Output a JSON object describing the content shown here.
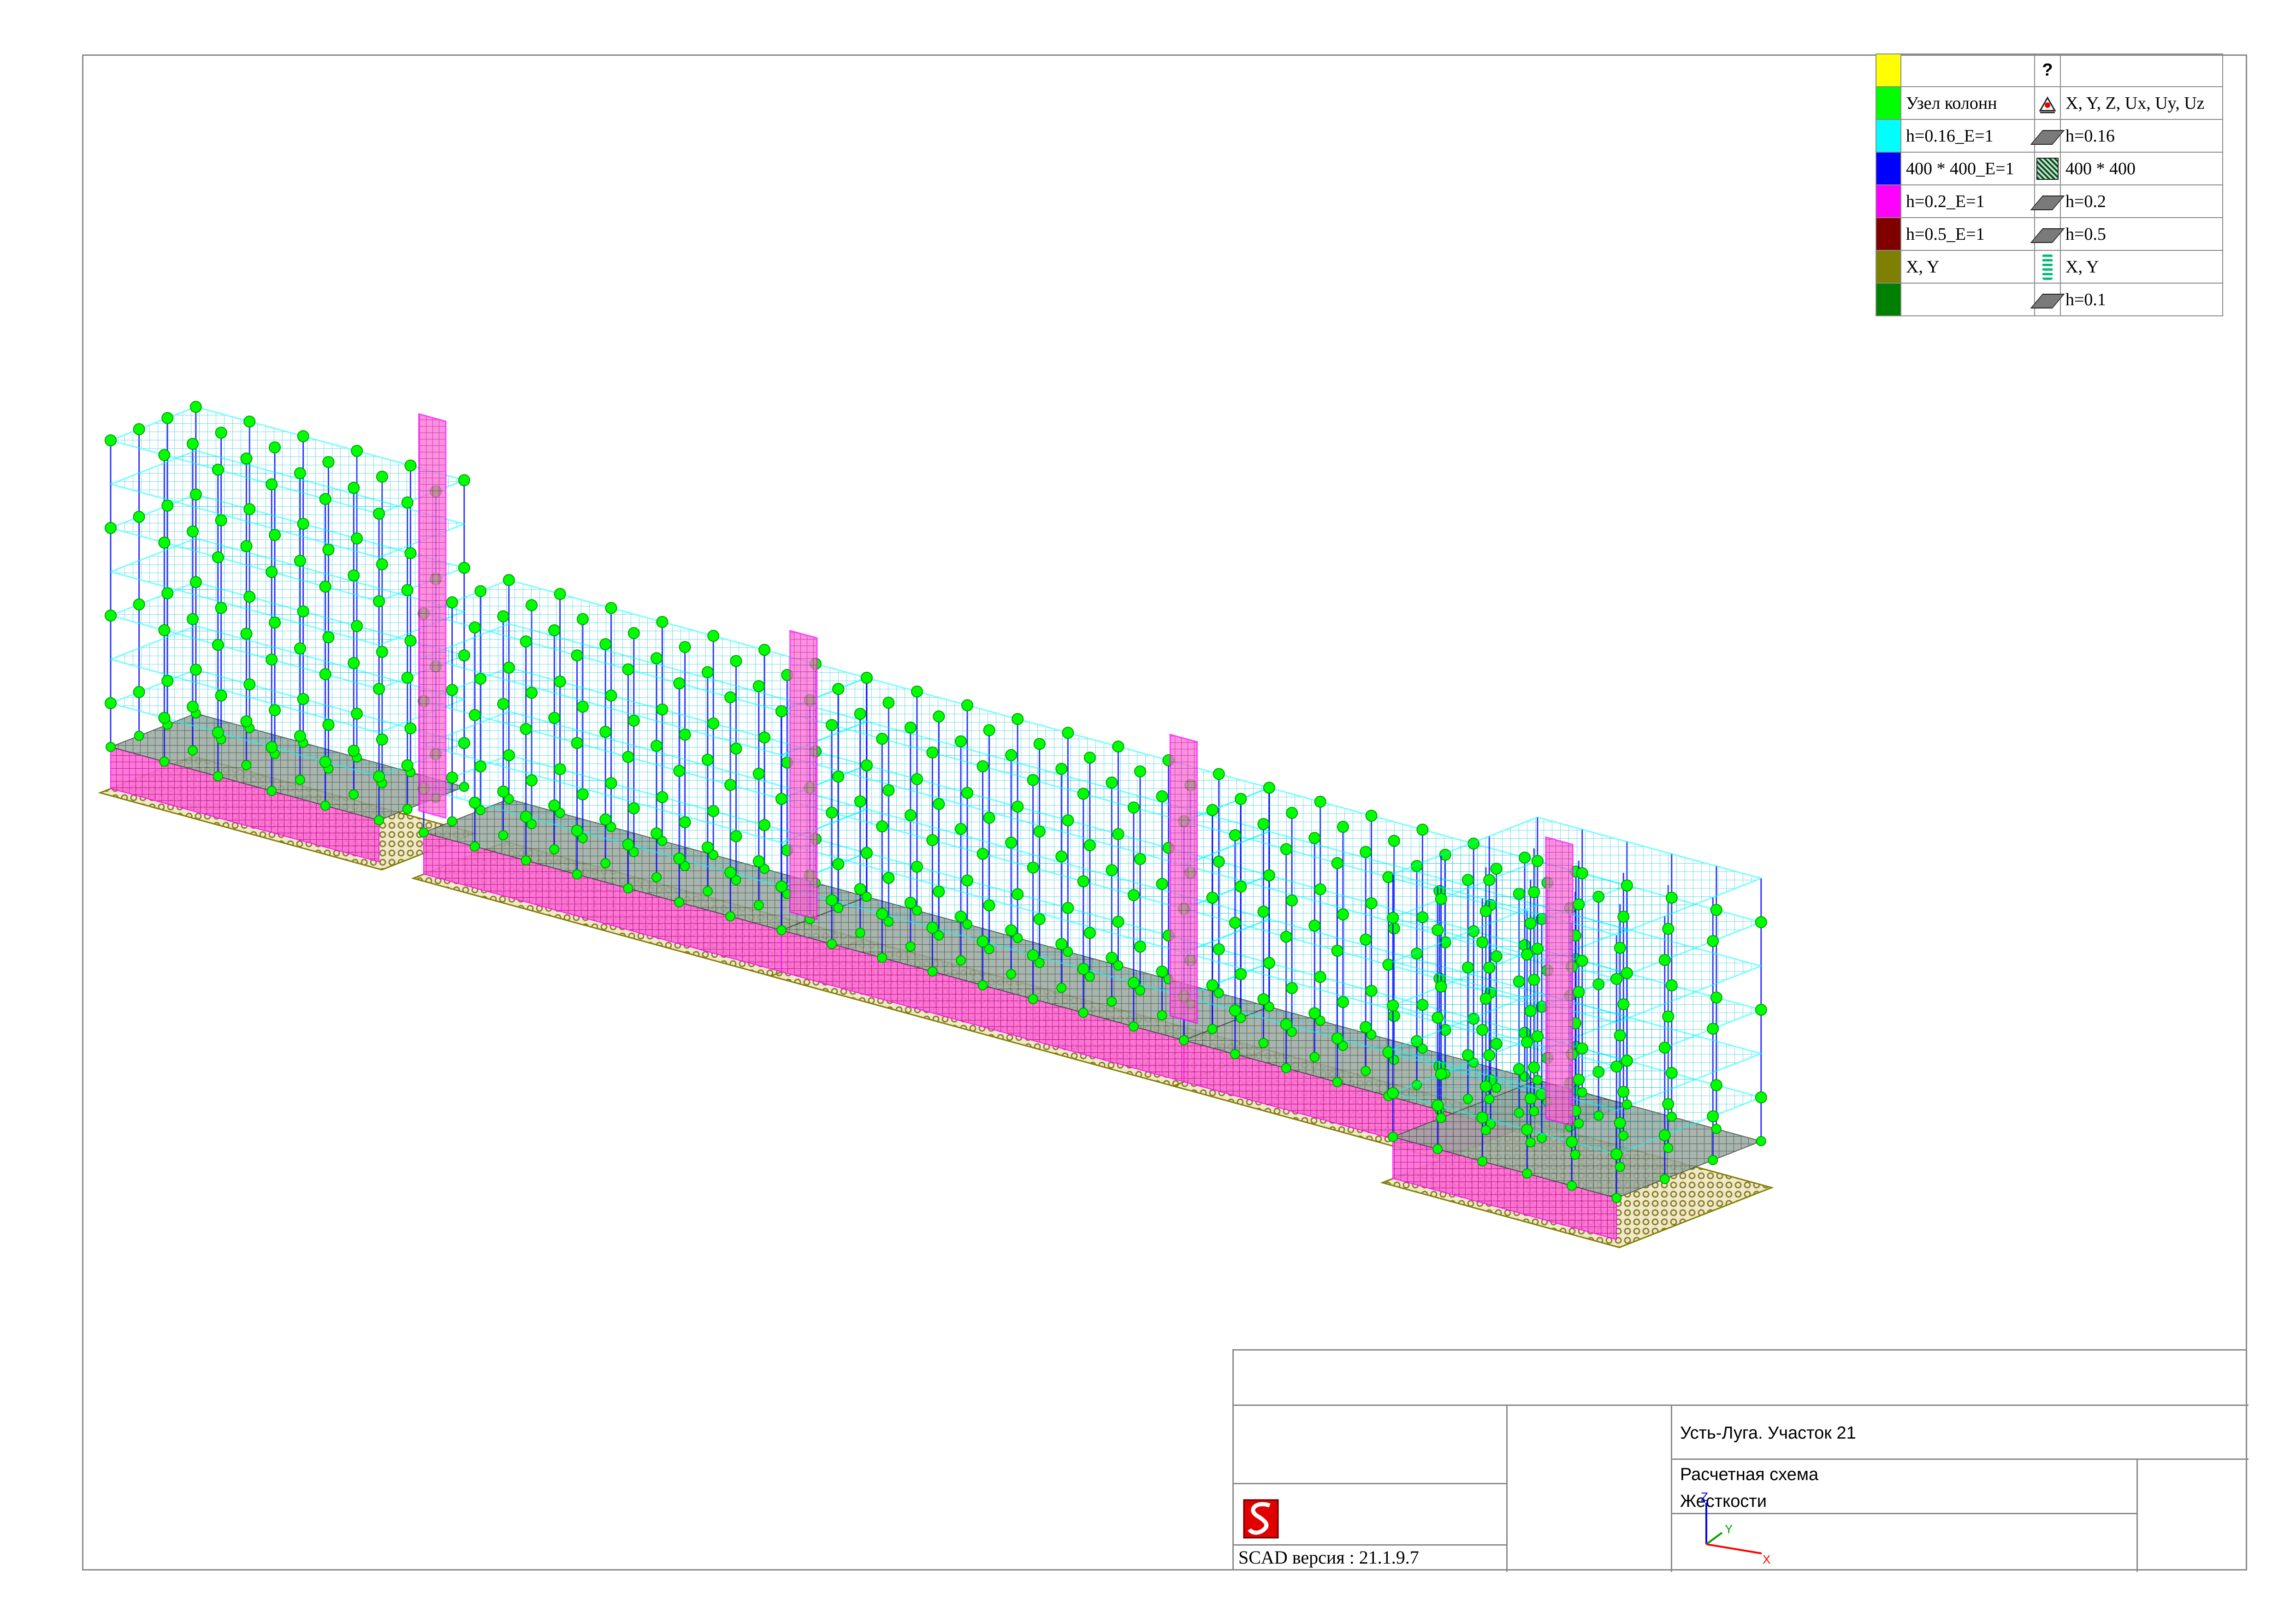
{
  "legend": {
    "header_mark": "?",
    "rows": [
      {
        "color": "#ffff00",
        "label": "",
        "icon": "",
        "icon_name": "",
        "value": ""
      },
      {
        "color": "#00ff00",
        "label": "Узел колонн",
        "icon": "fix",
        "icon_name": "fixed-support-icon",
        "value": "X, Y, Z, Ux, Uy, Uz"
      },
      {
        "color": "#00ffff",
        "label": "h=0.16_E=1",
        "icon": "plate",
        "icon_name": "plate-icon",
        "value": "h=0.16"
      },
      {
        "color": "#0000ff",
        "label": "400 * 400_E=1",
        "icon": "hatch",
        "icon_name": "section-icon",
        "value": "400 * 400"
      },
      {
        "color": "#ff00ff",
        "label": "h=0.2_E=1",
        "icon": "plate",
        "icon_name": "plate-icon",
        "value": "h=0.2"
      },
      {
        "color": "#800000",
        "label": "h=0.5_E=1",
        "icon": "plate",
        "icon_name": "plate-icon",
        "value": "h=0.5"
      },
      {
        "color": "#808000",
        "label": "X, Y",
        "icon": "spring",
        "icon_name": "elastic-support-icon",
        "value": "X, Y"
      },
      {
        "color": "#008000",
        "label": "",
        "icon": "plate",
        "icon_name": "plate-icon",
        "value": "h=0.1"
      }
    ]
  },
  "title_block": {
    "project": "Усть-Луга. Участок 21",
    "drawing_line1": "Расчетная схема",
    "drawing_line2": "Жесткости",
    "version": "SCAD версия : 21.1.9.7",
    "axis_z": "Z",
    "axis_y": "Y",
    "axis_x": "X"
  },
  "colors": {
    "slab": "#00ffff",
    "node": "#00ff00",
    "column": "#0000ff",
    "wall": "#ff00ff",
    "foundation": "#808000",
    "frame": "#8a8a8a"
  }
}
